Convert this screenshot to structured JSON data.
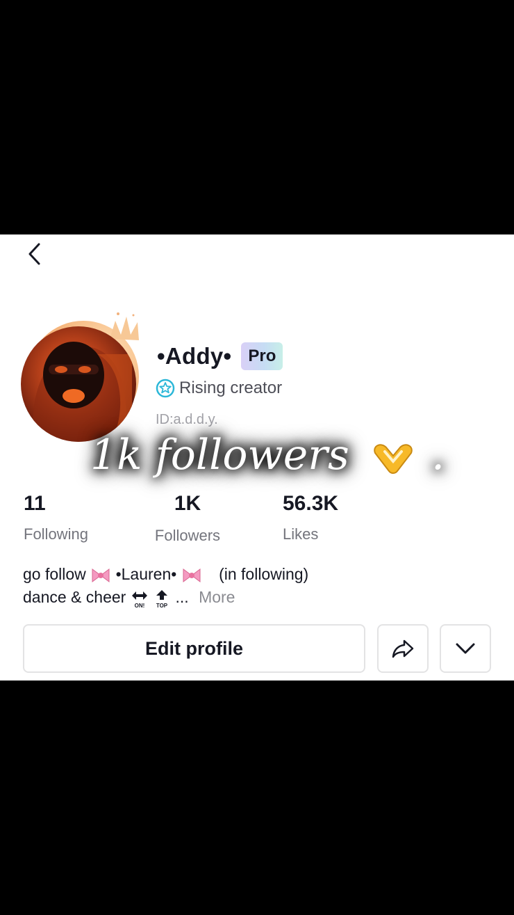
{
  "profile": {
    "name": "•Addy•",
    "badge": "Pro",
    "status": "Rising creator",
    "id": "ID:a.d.d.y."
  },
  "overlay": {
    "caption": "1k followers",
    "suffix": "."
  },
  "stats": [
    {
      "value": "11",
      "label": "Following"
    },
    {
      "value": "1K",
      "label": "Followers"
    },
    {
      "value": "56.3K",
      "label": "Likes"
    }
  ],
  "bio": {
    "line1_prefix": "go follow ",
    "line1_name": "•Lauren•",
    "line1_suffix": "(in following)",
    "line2_prefix": "dance & cheer",
    "ellipsis": "...",
    "more": "More"
  },
  "buttons": {
    "edit_profile": "Edit profile"
  },
  "icons": {
    "back": "chevron-left-icon",
    "share": "share-arrow-icon",
    "dropdown": "chevron-down-icon",
    "rising": "star-badge-icon"
  }
}
